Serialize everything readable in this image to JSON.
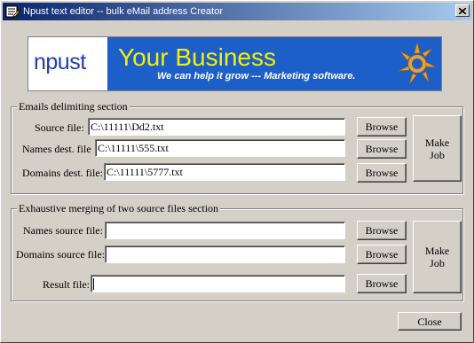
{
  "window": {
    "title": "Npust text editor -- bulk eMail address Creator",
    "close_glyph": "×"
  },
  "banner": {
    "logo_text": "npust",
    "headline": "Your Business",
    "tagline": "We can help it grow --- Marketing software.",
    "icon": "sun-logo-icon"
  },
  "delimiting": {
    "title": "Emails delimiting section",
    "source_label": "Source file:",
    "source_value": "C:\\11111\\Dd2.txt",
    "names_label": "Names dest. file",
    "names_value": "C:\\11111\\555.txt",
    "domains_label": "Domains dest. file:",
    "domains_value": "C:\\11111\\5777.txt",
    "browse_label": "Browse",
    "make_job_label": "Make\nJob"
  },
  "merging": {
    "title": "Exhaustive merging of two source files section",
    "names_label": "Names source file:",
    "names_value": "",
    "domains_label": "Domains source file:",
    "domains_value": "",
    "result_label": "Result file:",
    "result_value": "",
    "browse_label": "Browse",
    "make_job_label": "Make\nJob"
  },
  "footer": {
    "close_label": "Close"
  },
  "colors": {
    "face": "#d4d0c8",
    "titlebar_start": "#0a246a",
    "titlebar_end": "#a6caf0",
    "banner_blue": "#1c5fc9",
    "banner_yellow": "#f7f000",
    "logo_blue": "#1f3fa8",
    "sun_orange": "#f0a020"
  }
}
